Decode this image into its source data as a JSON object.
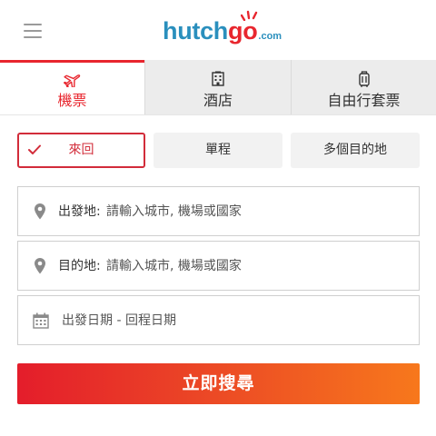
{
  "header": {
    "logo": {
      "text_main": "hutch",
      "text_accent": "go",
      "text_suffix": ".com"
    },
    "icons": {
      "menu": "hamburger-menu-icon"
    }
  },
  "tabs": [
    {
      "label": "機票",
      "icon": "airplane-icon",
      "active": true
    },
    {
      "label": "酒店",
      "icon": "hotel-building-icon",
      "active": false
    },
    {
      "label": "自由行套票",
      "icon": "luggage-icon",
      "active": false
    }
  ],
  "trip_types": [
    {
      "label": "來回",
      "selected": true
    },
    {
      "label": "單程",
      "selected": false
    },
    {
      "label": "多個目的地",
      "selected": false
    }
  ],
  "form": {
    "origin": {
      "label": "出發地:",
      "placeholder": "請輸入城市, 機場或國家"
    },
    "destination": {
      "label": "目的地:",
      "placeholder": "請輸入城市, 機場或國家"
    },
    "dates": {
      "placeholder": "出發日期 - 回程日期"
    }
  },
  "search_button": {
    "label": "立即搜尋"
  },
  "colors": {
    "brand_blue": "#2a8fbd",
    "brand_red": "#e8262e",
    "gradient_end": "#f7781c",
    "selected_border": "#d22c3a"
  }
}
